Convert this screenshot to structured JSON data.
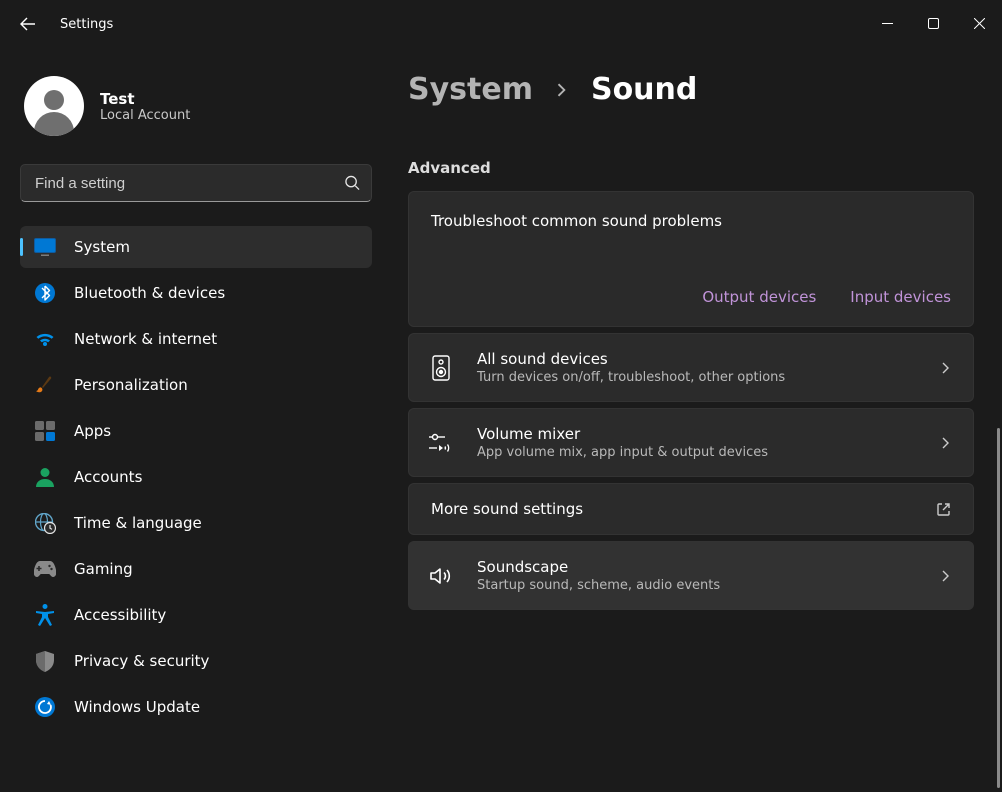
{
  "window": {
    "title": "Settings"
  },
  "profile": {
    "name": "Test",
    "subtitle": "Local Account"
  },
  "search": {
    "placeholder": "Find a setting"
  },
  "sidebar": {
    "items": [
      {
        "label": "System",
        "active": true
      },
      {
        "label": "Bluetooth & devices"
      },
      {
        "label": "Network & internet"
      },
      {
        "label": "Personalization"
      },
      {
        "label": "Apps"
      },
      {
        "label": "Accounts"
      },
      {
        "label": "Time & language"
      },
      {
        "label": "Gaming"
      },
      {
        "label": "Accessibility"
      },
      {
        "label": "Privacy & security"
      },
      {
        "label": "Windows Update"
      }
    ]
  },
  "breadcrumb": {
    "parent": "System",
    "current": "Sound"
  },
  "main": {
    "section_advanced": "Advanced",
    "troubleshoot": {
      "title": "Troubleshoot common sound problems",
      "link_output": "Output devices",
      "link_input": "Input devices"
    },
    "rows": {
      "all_devices": {
        "title": "All sound devices",
        "sub": "Turn devices on/off, troubleshoot, other options"
      },
      "volume_mixer": {
        "title": "Volume mixer",
        "sub": "App volume mix, app input & output devices"
      },
      "more_settings": {
        "title": "More sound settings"
      },
      "soundscape": {
        "title": "Soundscape",
        "sub": "Startup sound, scheme, audio events"
      }
    }
  }
}
